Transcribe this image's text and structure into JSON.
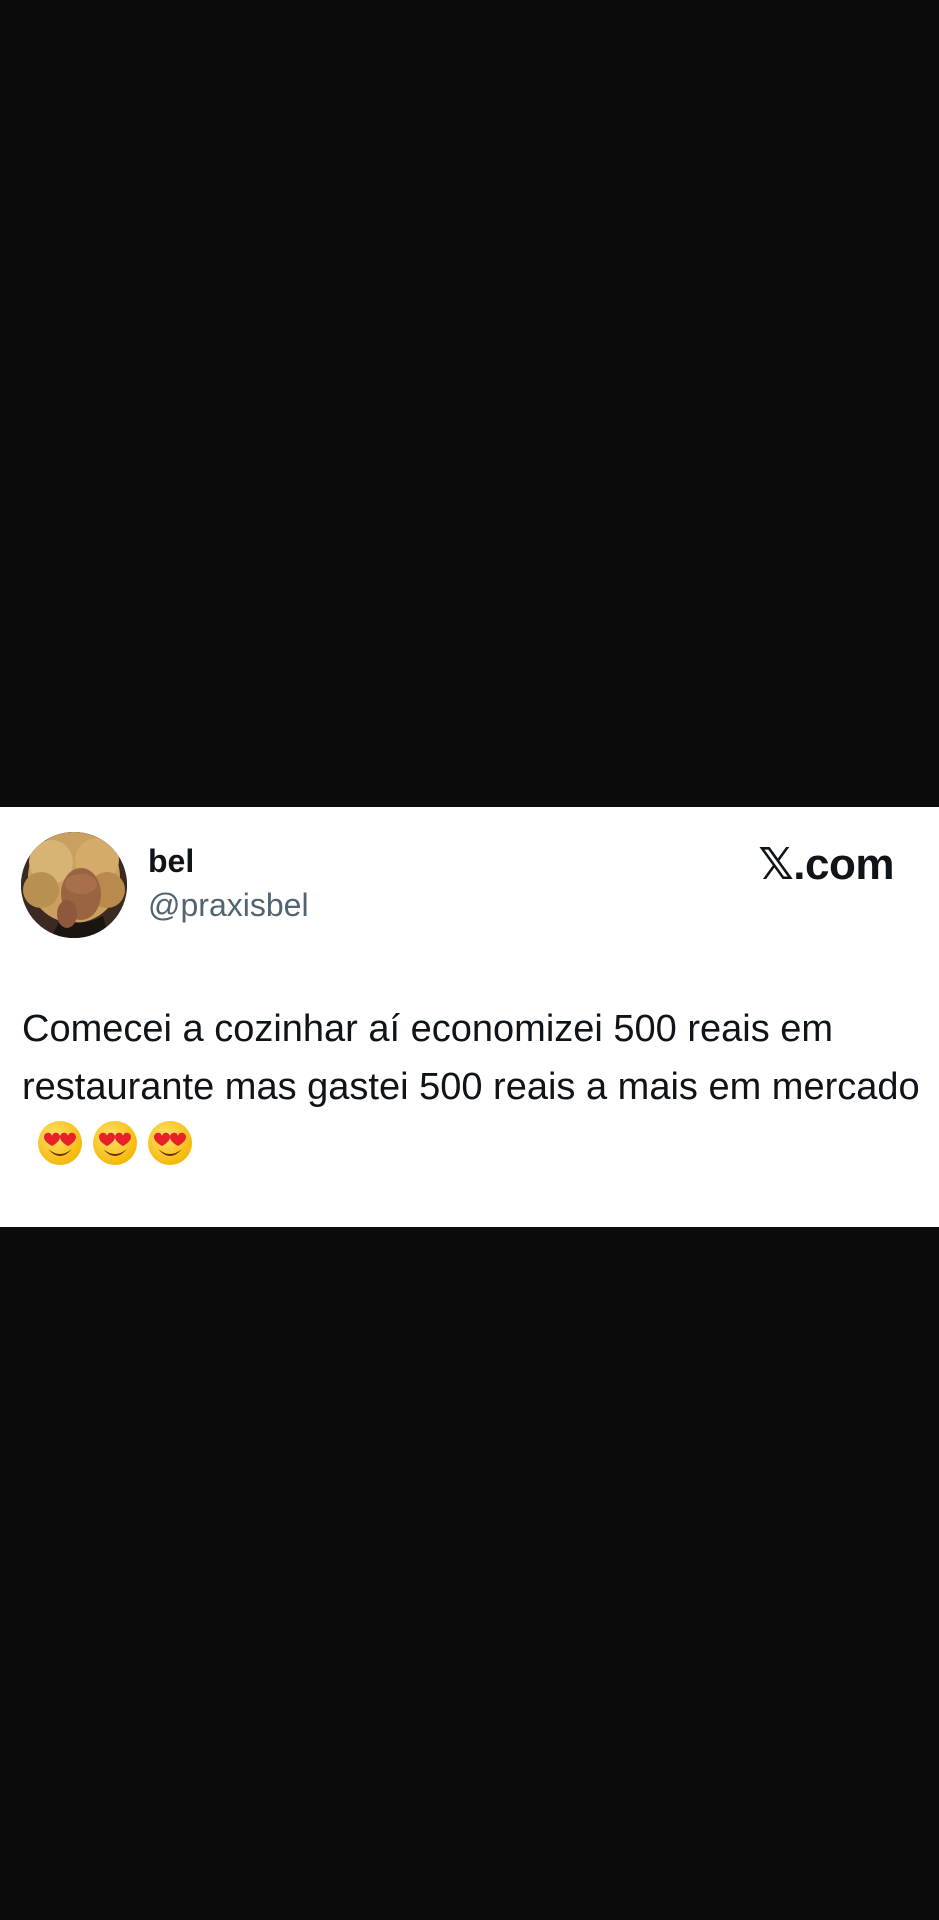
{
  "tweet": {
    "display_name": "bel",
    "handle": "@praxisbel",
    "brand": "𝕏.com",
    "text": "Comecei a cozinhar aí economizei 500 reais em restaurante mas gastei 500 reais a mais em mercado",
    "emojis": [
      "heart-eyes-emoji",
      "heart-eyes-emoji",
      "heart-eyes-emoji"
    ]
  },
  "colors": {
    "background": "#0b0b0b",
    "card": "#ffffff",
    "text_primary": "#0f1419",
    "text_secondary": "#536471"
  }
}
